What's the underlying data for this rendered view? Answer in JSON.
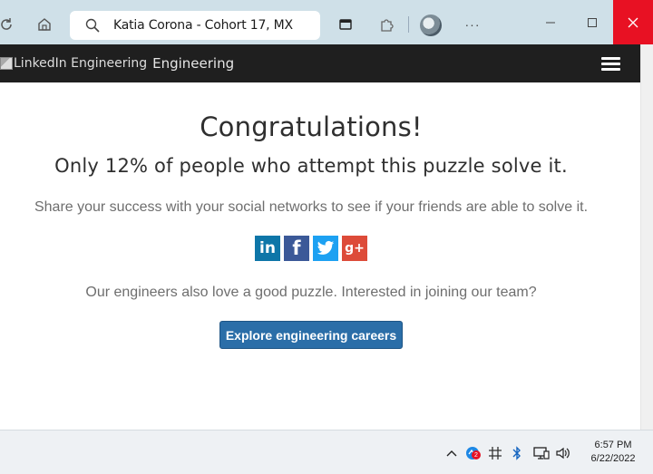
{
  "browser": {
    "address_text": "Katia Corona - Cohort 17, MX",
    "more_label": "···"
  },
  "site": {
    "logo_alt": "LinkedIn Engineering",
    "brand_text": "Engineering"
  },
  "main": {
    "title": "Congratulations!",
    "subtitle": "Only 12% of people who attempt this puzzle solve it.",
    "share_text": "Share your success with your social networks to see if your friends are able to solve it.",
    "social": [
      {
        "name": "linkedin",
        "glyph": "in",
        "color": "#0e76a8"
      },
      {
        "name": "facebook",
        "glyph": "f",
        "color": "#3b5998"
      },
      {
        "name": "twitter",
        "glyph": "twitter-bird",
        "color": "#1da1f2"
      },
      {
        "name": "google-plus",
        "glyph": "g+",
        "color": "#dd4b39"
      }
    ],
    "engineers_text": "Our engineers also love a good puzzle. Interested in joining our team?",
    "cta_label": "Explore engineering careers",
    "cta_color": "#2b6ea8"
  },
  "taskbar": {
    "badge_count": "2",
    "time": "6:57 PM",
    "date": "6/22/2022"
  }
}
